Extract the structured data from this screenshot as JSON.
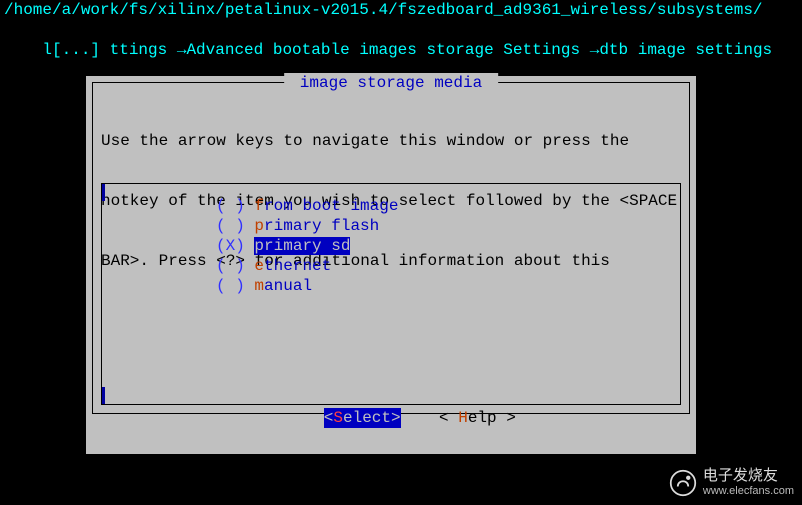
{
  "path": "/home/a/work/fs/xilinx/petalinux-v2015.4/fszedboard_ad9361_wireless/subsystems/",
  "breadcrumb": {
    "prefix": "l[...] ttings ",
    "arrow1": "→",
    "sect1": "Advanced bootable images storage Settings ",
    "arrow2": "→",
    "sect2": "dtb image settings"
  },
  "dialog": {
    "title": " image storage media ",
    "help1": "Use the arrow keys to navigate this window or press the",
    "help2": "hotkey of the item you wish to select followed by the <SPACE",
    "help3": "BAR>. Press <?> for additional information about this",
    "options": [
      {
        "mark": "( )",
        "hot": "f",
        "rest": "rom boot image",
        "selected": false
      },
      {
        "mark": "( )",
        "hot": "p",
        "rest": "rimary flash",
        "selected": false
      },
      {
        "mark": "(X)",
        "hot": "p",
        "rest": "rimary sd",
        "selected": true
      },
      {
        "mark": "( )",
        "hot": "e",
        "rest": "thernet",
        "selected": false
      },
      {
        "mark": "( )",
        "hot": "m",
        "rest": "anual",
        "selected": false
      }
    ],
    "buttons": {
      "select": {
        "lt": "<",
        "hot": "S",
        "rest": "elect",
        "gt": ">"
      },
      "help": {
        "lt": "< ",
        "hot": "H",
        "rest": "elp ",
        "gt": ">"
      }
    }
  },
  "watermark_faint": "",
  "credit": {
    "cn": "电子发烧友",
    "url": "www.elecfans.com"
  }
}
